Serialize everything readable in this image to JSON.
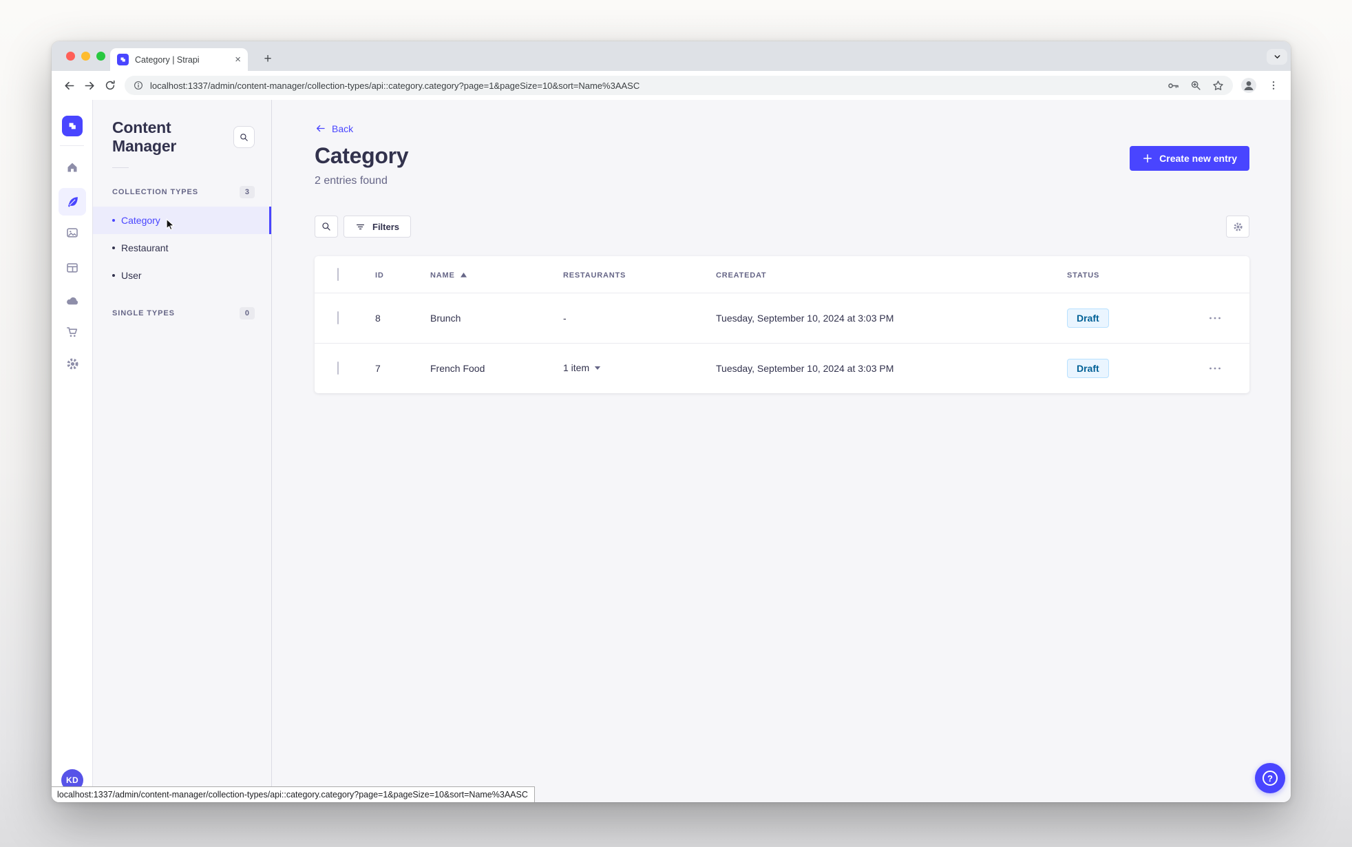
{
  "colors": {
    "primary": "#4945ff",
    "title_text": "#32324d",
    "muted_text": "#666687",
    "subnav_active_bg": "#ececfc",
    "draft_text": "#006096",
    "draft_bg": "#eaf5ff",
    "draft_border": "#b8e1ff",
    "rail_icon": "#8e8ea9",
    "tabbar_bg": "#dee1e6"
  },
  "glyphs": {
    "close_tab": "×",
    "new_tab": "+",
    "help": "?"
  },
  "browser": {
    "tab_title": "Category | Strapi",
    "url": "localhost:1337/admin/content-manager/collection-types/api::category.category?page=1&pageSize=10&sort=Name%3AASC",
    "status_url": "localhost:1337/admin/content-manager/collection-types/api::category.category?page=1&pageSize=10&sort=Name%3AASC"
  },
  "rail": {
    "avatar_initials": "KD"
  },
  "subnav": {
    "title": "Content Manager",
    "collection_types_label": "COLLECTION TYPES",
    "collection_types_count": "3",
    "items": [
      {
        "label": "Category"
      },
      {
        "label": "Restaurant"
      },
      {
        "label": "User"
      }
    ],
    "single_types_label": "SINGLE TYPES",
    "single_types_count": "0"
  },
  "main": {
    "back_label": "Back",
    "title": "Category",
    "subtitle": "2 entries found",
    "create_button_label": "Create new entry",
    "filters_label": "Filters",
    "table": {
      "headers": {
        "id": "ID",
        "name": "NAME",
        "restaurants": "RESTAURANTS",
        "createdat": "CREATEDAT",
        "status": "STATUS"
      },
      "rows": [
        {
          "id": "8",
          "name": "Brunch",
          "restaurants": "-",
          "createdat": "Tuesday, September 10, 2024 at 3:03 PM",
          "status": "Draft"
        },
        {
          "id": "7",
          "name": "French Food",
          "restaurants": "1 item",
          "createdat": "Tuesday, September 10, 2024 at 3:03 PM",
          "status": "Draft"
        }
      ]
    }
  }
}
